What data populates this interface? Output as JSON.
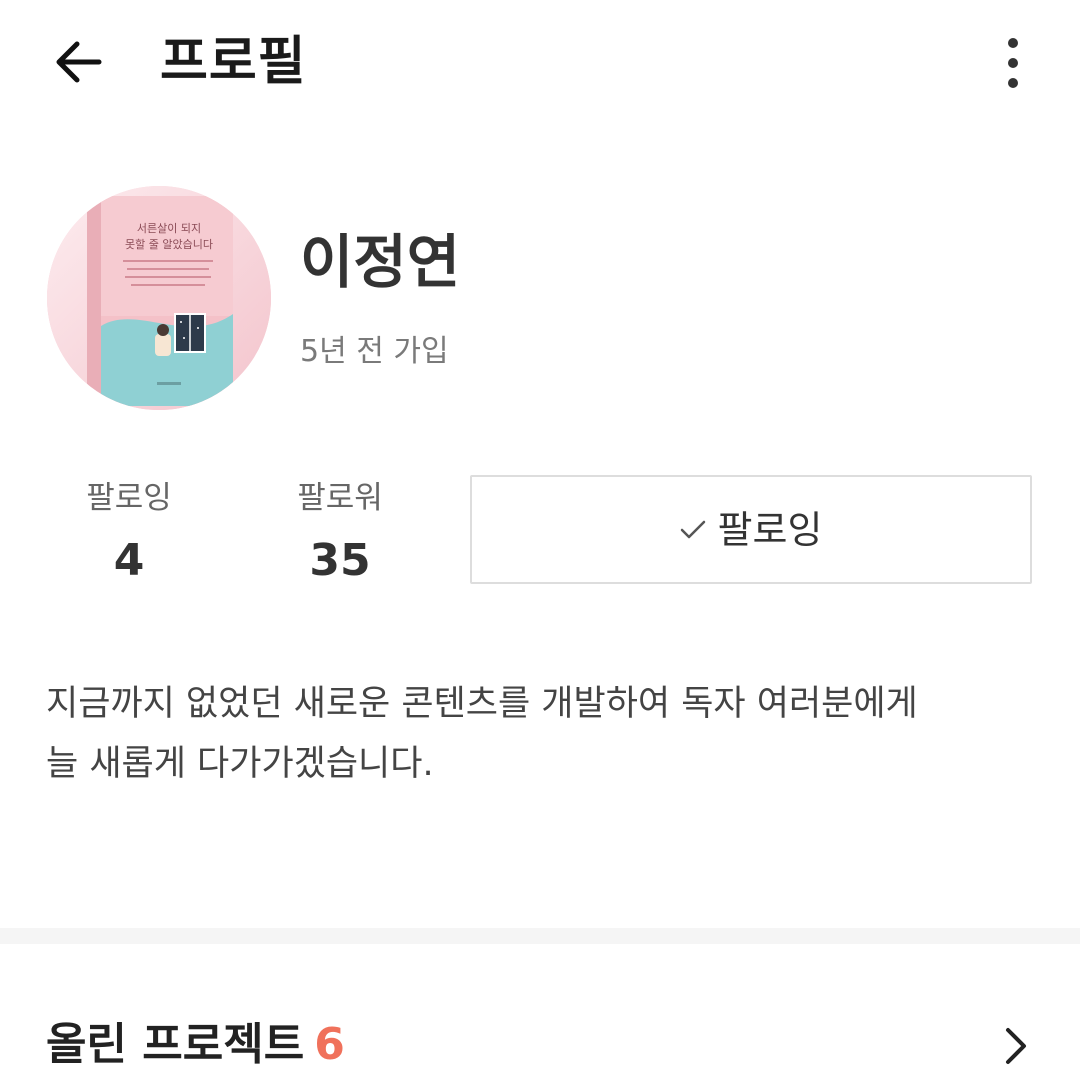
{
  "header": {
    "title": "프로필",
    "back_icon": "arrow-left-icon",
    "more_icon": "more-vertical-icon"
  },
  "profile": {
    "name": "이정연",
    "joined": "5년 전 가입",
    "avatar": {
      "book_title_line1": "서른살이 되지",
      "book_title_line2": "못할 줄 알았습니다"
    }
  },
  "stats": {
    "following_label": "팔로잉",
    "following_count": "4",
    "followers_label": "팔로워",
    "followers_count": "35"
  },
  "follow_button": {
    "label": "팔로잉",
    "icon": "check-icon"
  },
  "bio": {
    "line1": "지금까지 없었던 새로운 콘텐츠를 개발하여 독자 여러분에게",
    "line2": "늘 새롭게 다가가겠습니다."
  },
  "projects_section": {
    "title": "올린 프로젝트",
    "count": "6",
    "chevron_icon": "chevron-right-icon"
  },
  "colors": {
    "accent": "#f0715b",
    "text_primary": "#222222",
    "text_secondary": "#7a7a7a",
    "border": "#dddddd",
    "divider": "#f5f5f5"
  }
}
